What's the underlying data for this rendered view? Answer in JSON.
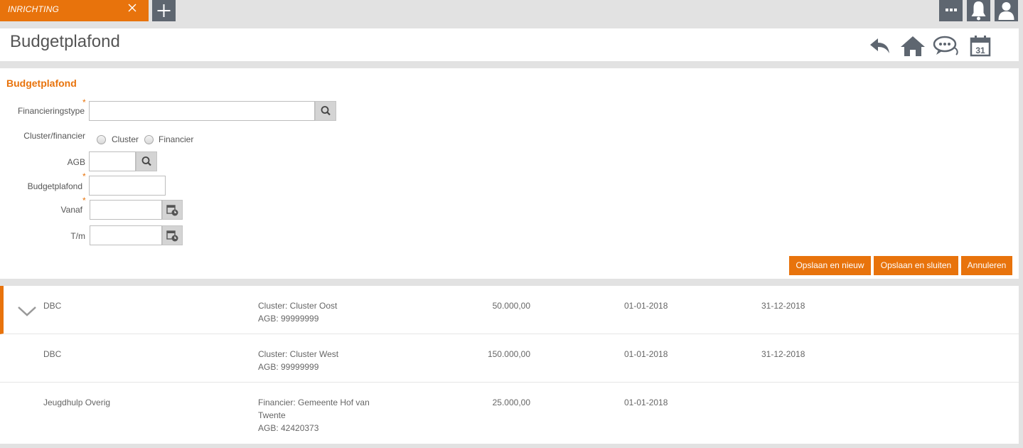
{
  "tab": {
    "label": "INRICHTING"
  },
  "header": {
    "title": "Budgetplafond"
  },
  "form": {
    "section_title": "Budgetplafond",
    "fields": {
      "financieringstype": {
        "label": "Financieringstype",
        "value": "",
        "required": "*"
      },
      "cluster_financier": {
        "label": "Cluster/financier",
        "options": [
          "Cluster",
          "Financier"
        ]
      },
      "agb": {
        "label": "AGB",
        "value": ""
      },
      "budgetplafond": {
        "label": "Budgetplafond",
        "value": "",
        "required": "*"
      },
      "vanaf": {
        "label": "Vanaf",
        "value": "",
        "required": "*"
      },
      "tm": {
        "label": "T/m",
        "value": ""
      }
    },
    "buttons": {
      "save_new": "Opslaan en nieuw",
      "save_close": "Opslaan en sluiten",
      "cancel": "Annuleren"
    }
  },
  "list": {
    "rows": [
      {
        "type": "DBC",
        "desc": [
          "Cluster: Cluster Oost",
          "AGB: 99999999"
        ],
        "amount": "50.000,00",
        "from": "01-01-2018",
        "to": "31-12-2018"
      },
      {
        "type": "DBC",
        "desc": [
          "Cluster: Cluster West",
          "AGB: 99999999"
        ],
        "amount": "150.000,00",
        "from": "01-01-2018",
        "to": "31-12-2018"
      },
      {
        "type": "Jeugdhulp Overig",
        "desc": [
          "Financier: Gemeente Hof van",
          "Twente",
          "AGB: 42420373"
        ],
        "amount": "25.000,00",
        "from": "01-01-2018",
        "to": ""
      }
    ]
  },
  "colors": {
    "accent": "#e8730c",
    "icon_dark": "#5e6670"
  },
  "icons": [
    "close-icon",
    "plus-icon",
    "more-icon",
    "bell-icon",
    "user-icon",
    "back-icon",
    "home-icon",
    "chat-icon",
    "calendar-icon",
    "search-icon",
    "calendar-clock-icon",
    "chevron-down-icon"
  ]
}
